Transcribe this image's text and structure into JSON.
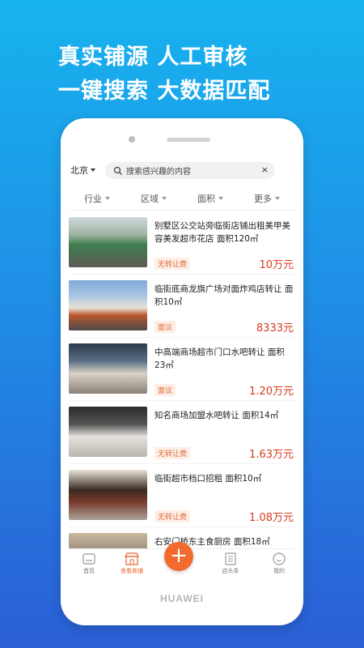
{
  "promo": {
    "line1": "真实铺源 人工审核",
    "line2": "一键搜索 大数据匹配"
  },
  "device": {
    "brand": "HUAWEI"
  },
  "header": {
    "city": "北京",
    "search_placeholder": "搜索感兴趣的内容",
    "clear": "×"
  },
  "filters": [
    {
      "label": "行业"
    },
    {
      "label": "区域"
    },
    {
      "label": "面积"
    },
    {
      "label": "更多"
    }
  ],
  "listings": [
    {
      "title": "别墅区公交站旁临街店铺出租美甲美容美发超市花店 面积120㎡",
      "tag": "无转让费",
      "price": "10万元"
    },
    {
      "title": "临街底商龙旗广场对面炸鸡店转让 面积10㎡",
      "tag": "面议",
      "price": "8333元"
    },
    {
      "title": "中高端商场超市门口水吧转让  面积23㎡",
      "tag": "面议",
      "price": "1.20万元"
    },
    {
      "title": "知名商场加盟水吧转让 面积14㎡",
      "tag": "无转让费",
      "price": "1.63万元"
    },
    {
      "title": "临街超市档口招租 面积10㎡",
      "tag": "无转让费",
      "price": "1.08万元"
    },
    {
      "title": "右安门桥东主食厨房 面积18㎡",
      "tag": "",
      "price": ""
    }
  ],
  "tabs": [
    {
      "label": "首页"
    },
    {
      "label": "查看商铺"
    },
    {
      "label": "店头条"
    },
    {
      "label": "我的"
    }
  ],
  "plus": "+",
  "colors": {
    "accent": "#f26a2c",
    "price": "#d73b1f",
    "bg_top": "#17b3ee",
    "bg_bottom": "#2b5fd6"
  }
}
